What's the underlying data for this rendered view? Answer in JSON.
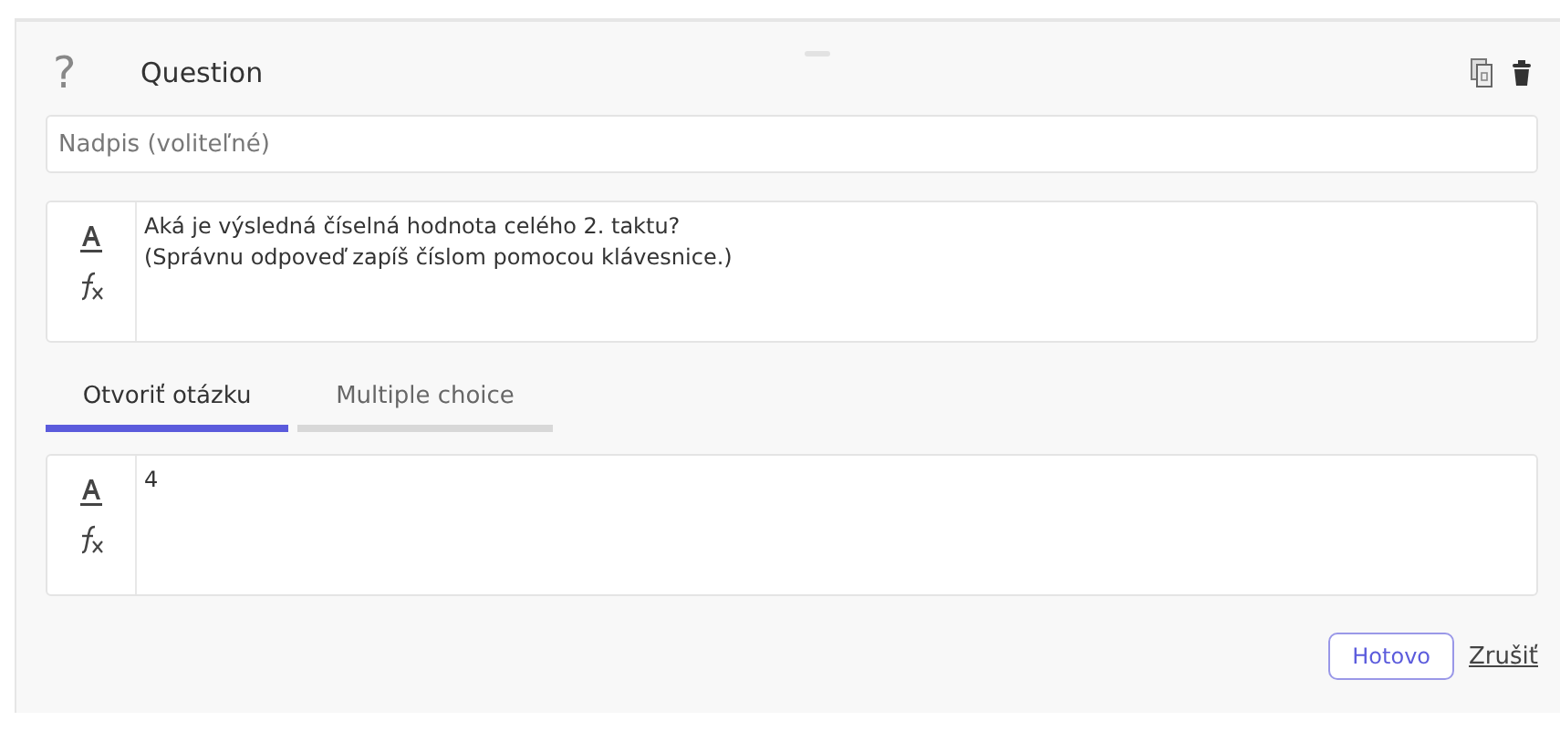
{
  "header": {
    "icon": "?",
    "title": "Question"
  },
  "title_field": {
    "placeholder": "Nadpis (voliteľné)"
  },
  "question_editor": {
    "lines": [
      "Aká je výsledná číselná hodnota celého 2. taktu?",
      "(Správnu odpoveď zapíš číslom pomocou klávesnice.)"
    ]
  },
  "tabs": [
    {
      "label": "Otvoriť otázku",
      "selected": true
    },
    {
      "label": "Multiple choice",
      "selected": false
    }
  ],
  "answer_editor": {
    "lines": [
      "4"
    ]
  },
  "buttons": [
    {
      "kind": "outlined",
      "label": "Hotovo"
    },
    {
      "kind": "link",
      "label": "Zrušiť"
    }
  ]
}
